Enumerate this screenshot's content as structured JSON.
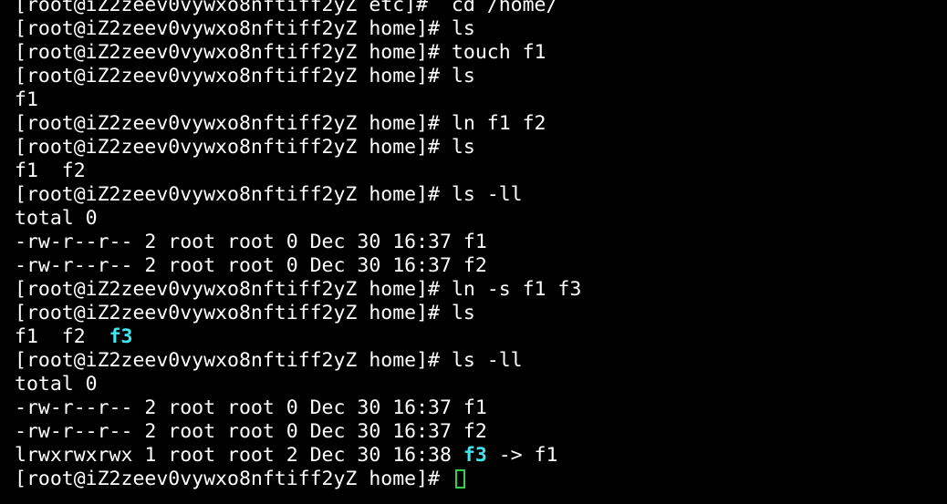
{
  "terminal": {
    "lines": [
      {
        "text": "[root@iZ2zeev0vywxo8nftiff2yZ etc]#  cd /home/"
      },
      {
        "text": "[root@iZ2zeev0vywxo8nftiff2yZ home]# ls"
      },
      {
        "text": "[root@iZ2zeev0vywxo8nftiff2yZ home]# touch f1"
      },
      {
        "text": "[root@iZ2zeev0vywxo8nftiff2yZ home]# ls"
      },
      {
        "text": "f1"
      },
      {
        "text": "[root@iZ2zeev0vywxo8nftiff2yZ home]# ln f1 f2"
      },
      {
        "text": "[root@iZ2zeev0vywxo8nftiff2yZ home]# ls"
      },
      {
        "text": "f1  f2"
      },
      {
        "text": "[root@iZ2zeev0vywxo8nftiff2yZ home]# ls -ll"
      },
      {
        "text": "total 0"
      },
      {
        "text": "-rw-r--r-- 2 root root 0 Dec 30 16:37 f1"
      },
      {
        "text": "-rw-r--r-- 2 root root 0 Dec 30 16:37 f2"
      },
      {
        "text": "[root@iZ2zeev0vywxo8nftiff2yZ home]# ln -s f1 f3"
      },
      {
        "text": "[root@iZ2zeev0vywxo8nftiff2yZ home]# ls"
      },
      {
        "pre": "f1  f2  ",
        "link": "f3",
        "post": ""
      },
      {
        "text": "[root@iZ2zeev0vywxo8nftiff2yZ home]# ls -ll"
      },
      {
        "text": "total 0"
      },
      {
        "text": "-rw-r--r-- 2 root root 0 Dec 30 16:37 f1"
      },
      {
        "text": "-rw-r--r-- 2 root root 0 Dec 30 16:37 f2"
      },
      {
        "pre": "lrwxrwxrwx 1 root root 2 Dec 30 16:38 ",
        "link": "f3",
        "post": " -> f1"
      },
      {
        "text": "[root@iZ2zeev0vywxo8nftiff2yZ home]# "
      }
    ],
    "colors": {
      "background": "#000000",
      "foreground": "#ffffff",
      "symlink": "#3ee8f0",
      "cursor": "#33d04a"
    }
  }
}
